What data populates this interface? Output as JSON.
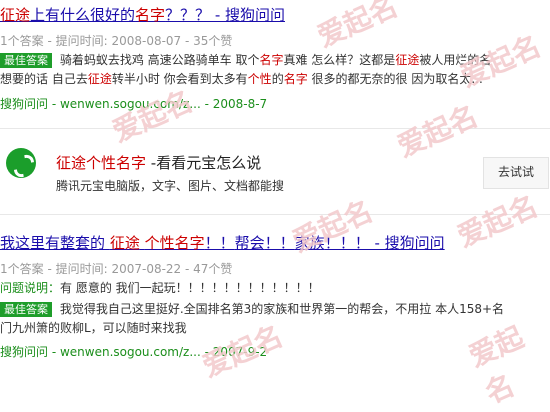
{
  "result1": {
    "title_parts": [
      "征途",
      "上有什么很好的",
      "名字",
      "？？？ - 搜狗问问"
    ],
    "meta": "1个答案 - 提问时间: 2008-08-07 - 35个赞",
    "answer_badge": "最佳答案",
    "snippet_line1_parts": [
      "骑着蚂蚁去找鸡 高速公路骑单车 取个",
      "名字",
      "真难 怎么样？这都是",
      "征途",
      "被人用烂的名"
    ],
    "snippet_line2_parts": [
      "想要的话 自己去",
      "征途",
      "转半小时 你会看到太多有",
      "个性",
      "的",
      "名字",
      " 很多的都无奈的很 因为取名太..."
    ],
    "source": "搜狗问问 - wenwen.sogou.com/z... - 2008-8-7"
  },
  "app_promo": {
    "title_parts": [
      "征途",
      "个性名字",
      " -看看元宝怎么说"
    ],
    "subtitle": "腾讯元宝电脑版，文字、图片、文档都能搜",
    "button_label": "去试试"
  },
  "result2": {
    "title_parts": [
      "我这里有",
      "整套",
      "的 ",
      "征途",
      " ",
      "个性名字",
      "！！",
      "帮会",
      "！！",
      "家族",
      "！！！ - 搜狗问问"
    ],
    "meta": "1个答案 - 提问时间: 2007-08-22 - 47个赞",
    "question_label": "问题说明：",
    "question_text": "有 愿意的 我们一起玩！！！！！！！！！！！！",
    "answer_badge": "最佳答案",
    "snippet_line1": "我觉得我自己这里挺好.全国排名第3的家族和世界第一的帮会，不用拉 本人158+名",
    "snippet_line2": "门九州箫的败柳L，可以随时来找我",
    "source": "搜狗问问 - wenwen.sogou.com/z... - 2007-9-2"
  },
  "watermark_text": "爱起名",
  "colors": {
    "link": "#1a0dab",
    "highlight": "#cc0000",
    "green": "#1b8e1b",
    "badge": "#1e9d2a",
    "watermark": "#f3c9cc"
  }
}
